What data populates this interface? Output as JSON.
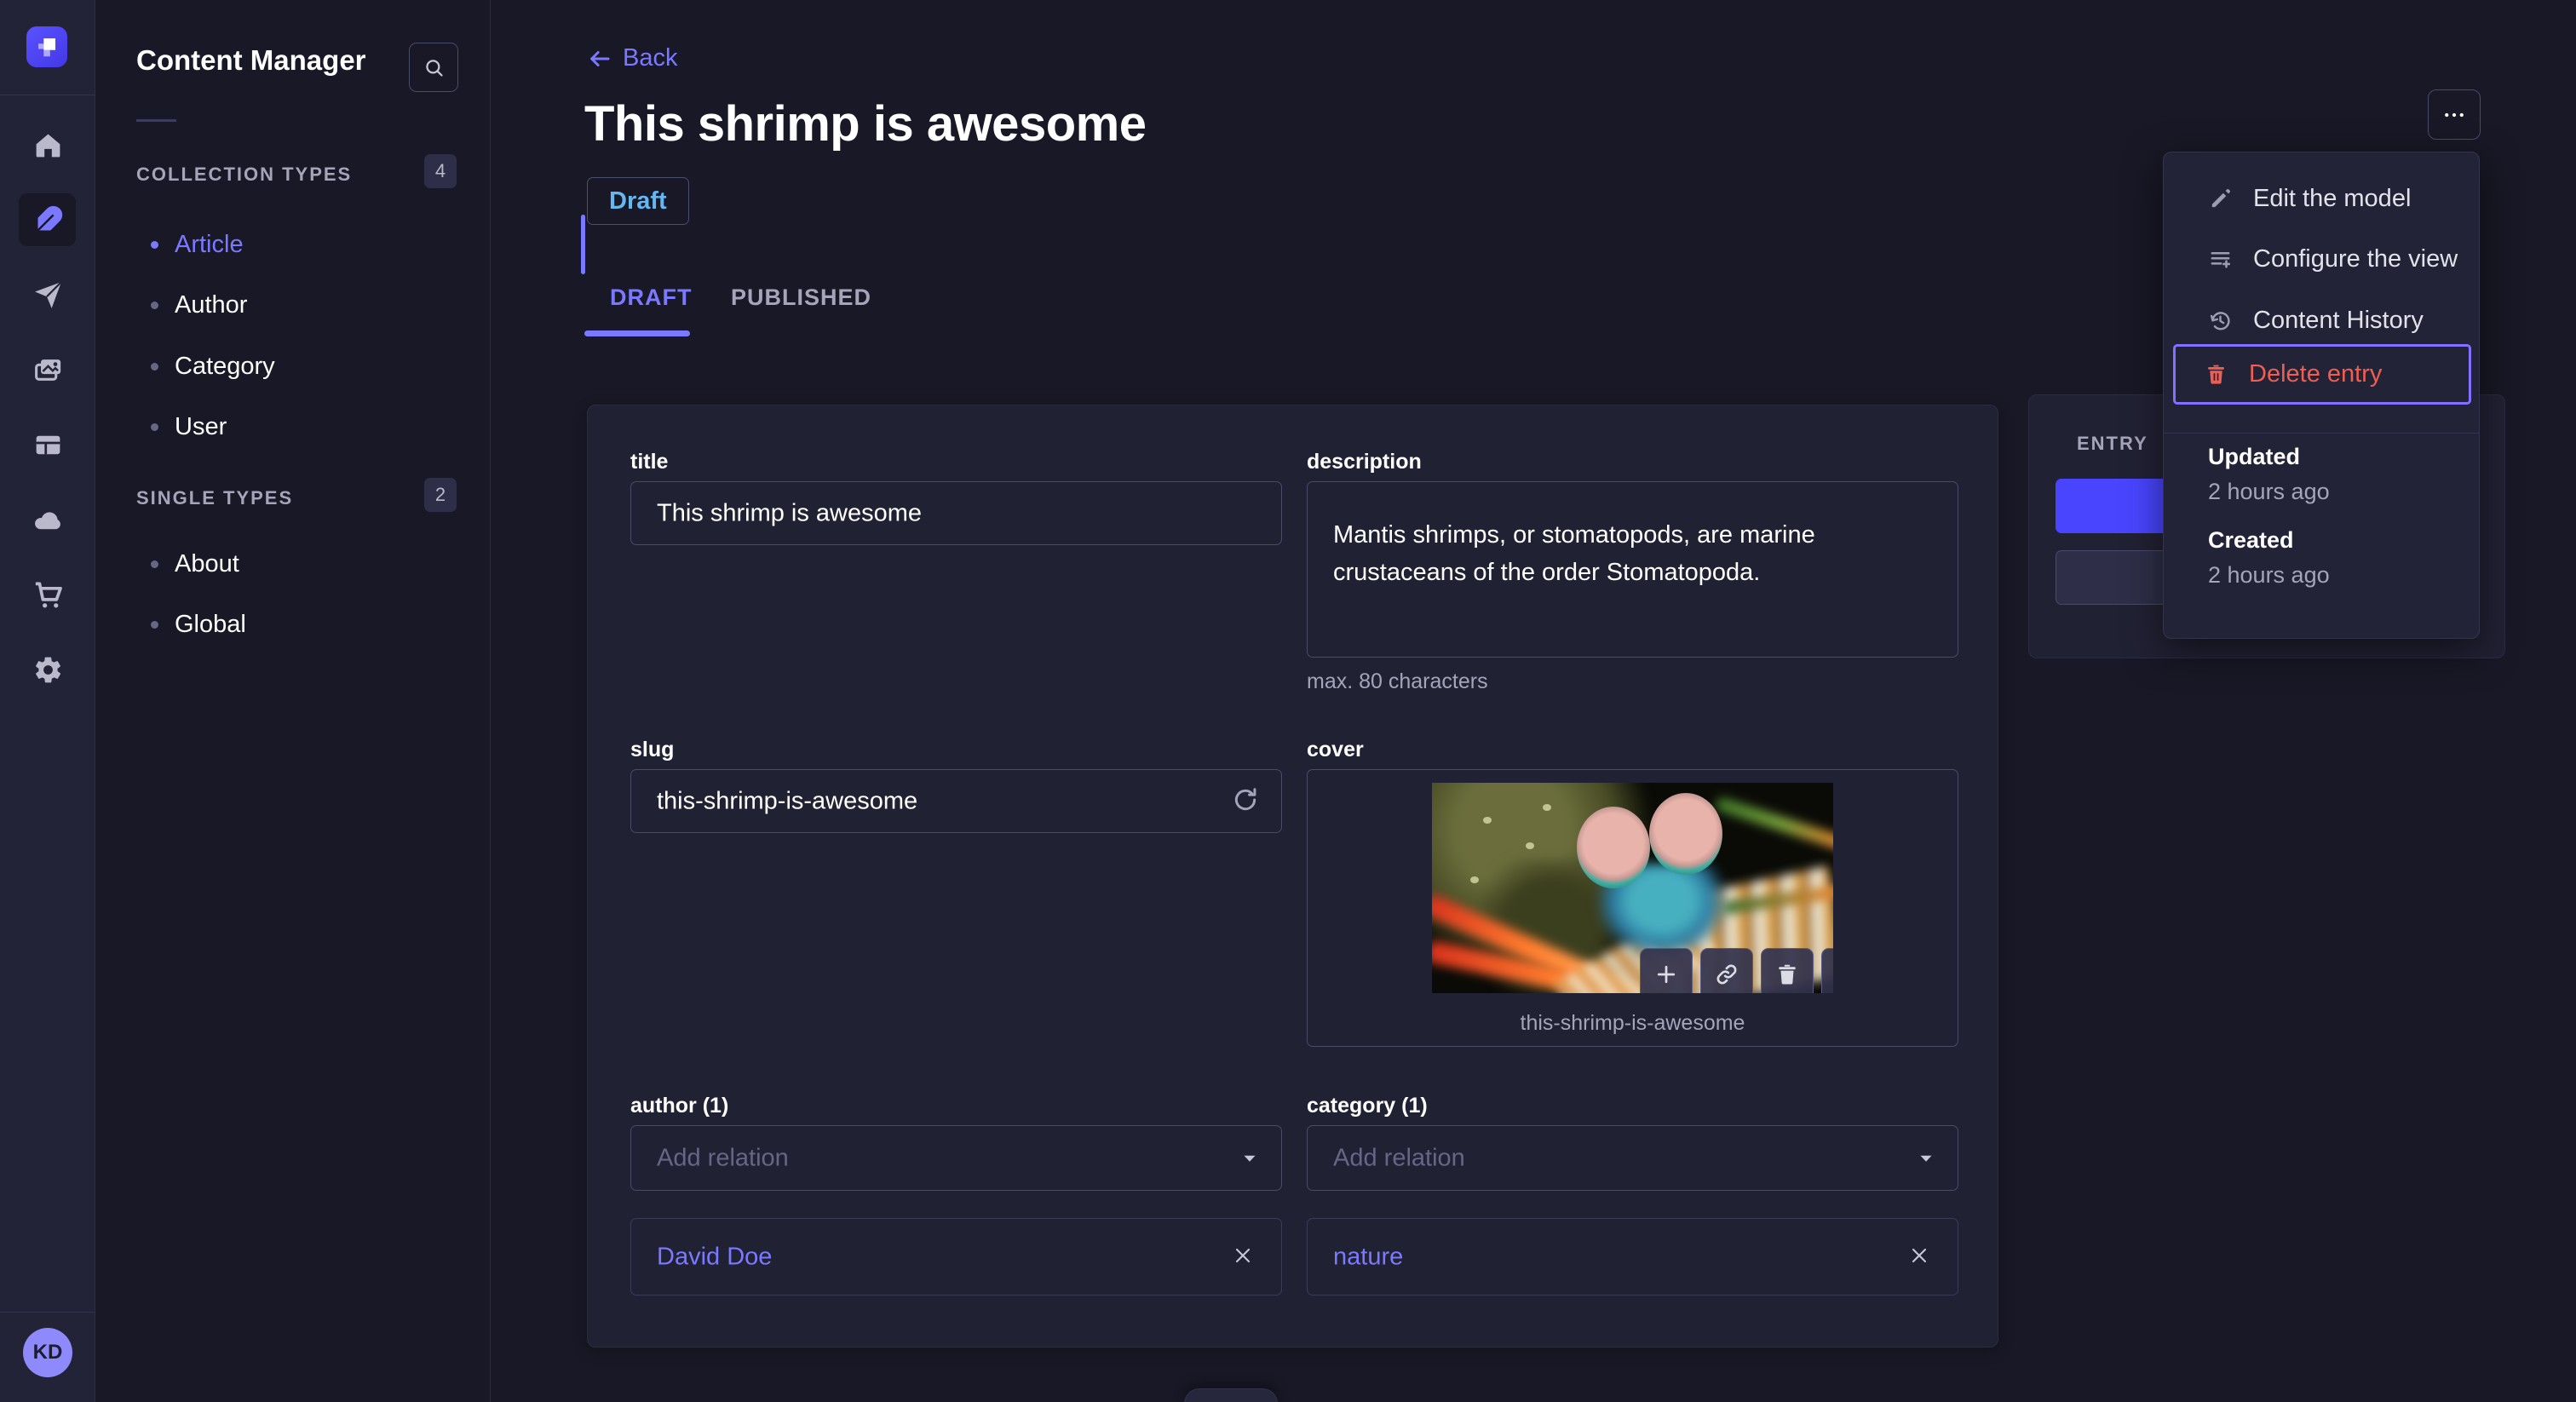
{
  "colors": {
    "accent": "#4945ff",
    "link": "#7b79ff",
    "danger": "#ee5e52",
    "draft_text": "#66b7f1"
  },
  "iconbar": {
    "avatar_initials": "KD"
  },
  "subnav": {
    "title": "Content Manager",
    "sections": [
      {
        "label": "COLLECTION TYPES",
        "count": "4",
        "items": [
          {
            "label": "Article"
          },
          {
            "label": "Author"
          },
          {
            "label": "Category"
          },
          {
            "label": "User"
          }
        ]
      },
      {
        "label": "SINGLE TYPES",
        "count": "2",
        "items": [
          {
            "label": "About"
          },
          {
            "label": "Global"
          }
        ]
      }
    ]
  },
  "header": {
    "back_label": "Back",
    "title": "This shrimp is awesome",
    "status_badge": "Draft",
    "tabs": [
      {
        "label": "DRAFT"
      },
      {
        "label": "PUBLISHED"
      }
    ]
  },
  "form": {
    "title": {
      "label": "title",
      "value": "This shrimp is awesome"
    },
    "description": {
      "label": "description",
      "value": "Mantis shrimps, or stomatopods, are marine\ncrustaceans of the order Stomatopoda.",
      "hint": "max. 80 characters"
    },
    "slug": {
      "label": "slug",
      "value": "this-shrimp-is-awesome"
    },
    "cover": {
      "label": "cover",
      "caption": "this-shrimp-is-awesome"
    },
    "author": {
      "label": "author (1)",
      "placeholder": "Add relation",
      "relation": "David Doe"
    },
    "category": {
      "label": "category (1)",
      "placeholder": "Add relation",
      "relation": "nature"
    }
  },
  "entry_panel": {
    "title": "ENTRY"
  },
  "menu": {
    "items": [
      {
        "label": "Edit the model"
      },
      {
        "label": "Configure the view"
      },
      {
        "label": "Content History"
      },
      {
        "label": "Delete entry"
      }
    ],
    "meta": [
      {
        "label": "Updated",
        "value": "2 hours ago"
      },
      {
        "label": "Created",
        "value": "2 hours ago"
      }
    ]
  }
}
